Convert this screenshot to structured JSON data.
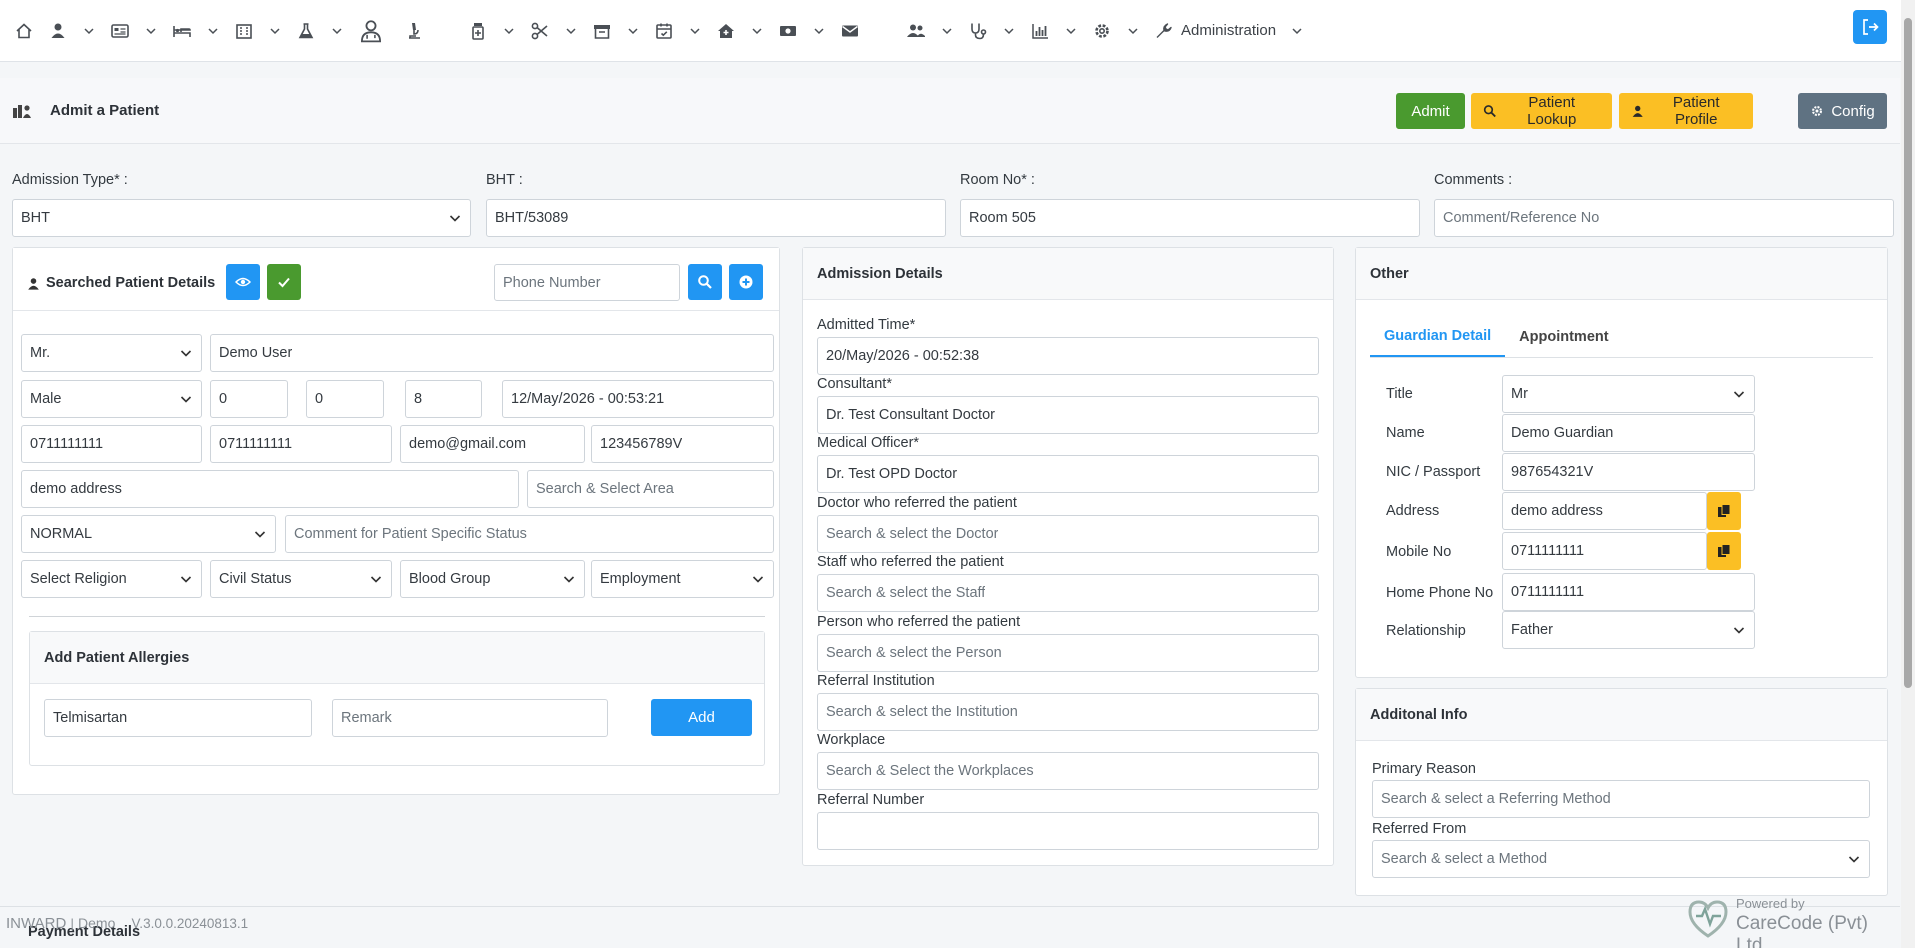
{
  "nav": {
    "administration_label": "Administration"
  },
  "header": {
    "title": "Admit a Patient",
    "admit_label": "Admit",
    "lookup_label": "Patient Lookup",
    "profile_label": "Patient Profile",
    "config_label": "Config"
  },
  "top_form": {
    "admission_type_label": "Admission Type* :",
    "admission_type_value": "BHT",
    "bht_label": "BHT :",
    "bht_value": "BHT/53089",
    "room_label": "Room No* :",
    "room_value": "Room 505",
    "comments_label": "Comments :",
    "comments_placeholder": "Comment/Reference No"
  },
  "patient": {
    "panel_title": "Searched Patient Details",
    "phone_placeholder": "Phone Number",
    "title_value": "Mr.",
    "name_value": "Demo User",
    "gender_value": "Male",
    "age_years": "0",
    "age_months": "0",
    "age_days": "8",
    "dob_value": "12/May/2026 - 00:53:21",
    "phone1": "0711111111",
    "phone2": "0711111111",
    "email": "demo@gmail.com",
    "nic": "123456789V",
    "address": "demo address",
    "area_placeholder": "Search & Select Area",
    "status_value": "NORMAL",
    "status_comment_placeholder": "Comment for Patient Specific Status",
    "religion_placeholder": "Select Religion",
    "civil_placeholder": "Civil Status",
    "blood_placeholder": "Blood Group",
    "employment_placeholder": "Employment",
    "allergy_panel_title": "Add Patient Allergies",
    "allergy_value": "Telmisartan",
    "remark_placeholder": "Remark",
    "add_label": "Add"
  },
  "admission": {
    "panel_title": "Admission Details",
    "admitted_time_label": "Admitted Time*",
    "admitted_time_value": "20/May/2026 - 00:52:38",
    "consultant_label": "Consultant*",
    "consultant_value": "Dr.  Test Consultant Doctor",
    "mo_label": "Medical Officer*",
    "mo_value": "Dr.  Test OPD Doctor",
    "ref_doctor_label": "Doctor who referred the patient",
    "ref_doctor_placeholder": "Search & select the Doctor",
    "ref_staff_label": "Staff who referred the patient",
    "ref_staff_placeholder": "Search & select the Staff",
    "ref_person_label": "Person who referred the patient",
    "ref_person_placeholder": "Search & select the Person",
    "ref_inst_label": "Referral Institution",
    "ref_inst_placeholder": "Search & select the Institution",
    "workplace_label": "Workplace",
    "workplace_placeholder": "Search & Select the Workplaces",
    "ref_number_label": "Referral Number",
    "ref_number_value": ""
  },
  "other": {
    "panel_title": "Other",
    "tab_guardian": "Guardian Detail",
    "tab_appointment": "Appointment",
    "title_label": "Title",
    "title_value": "Mr",
    "name_label": "Name",
    "name_value": "Demo Guardian",
    "nic_label": "NIC / Passport",
    "nic_value": "987654321V",
    "address_label": "Address",
    "address_value": "demo address",
    "mobile_label": "Mobile No",
    "mobile_value": "0711111111",
    "home_label": "Home Phone No",
    "home_value": "0711111111",
    "relationship_label": "Relationship",
    "relationship_value": "Father"
  },
  "additional": {
    "panel_title": "Additonal Info",
    "primary_label": "Primary Reason",
    "primary_placeholder": "Search & select a Referring Method",
    "referred_label": "Referred From",
    "referred_placeholder": "Search & select a Method"
  },
  "footer": {
    "module": "INWARD",
    "separator": "|",
    "instance": "Demo",
    "version": "V.3.0.0.20240813.1",
    "payment_title": "Payment Details",
    "powered_by": "Powered by",
    "brand": "CareCode (Pvt) Ltd."
  },
  "colors": {
    "primary": "#2196f3",
    "success": "#4a9a2f",
    "warning": "#fbbf24",
    "secondary": "#5f7282"
  }
}
